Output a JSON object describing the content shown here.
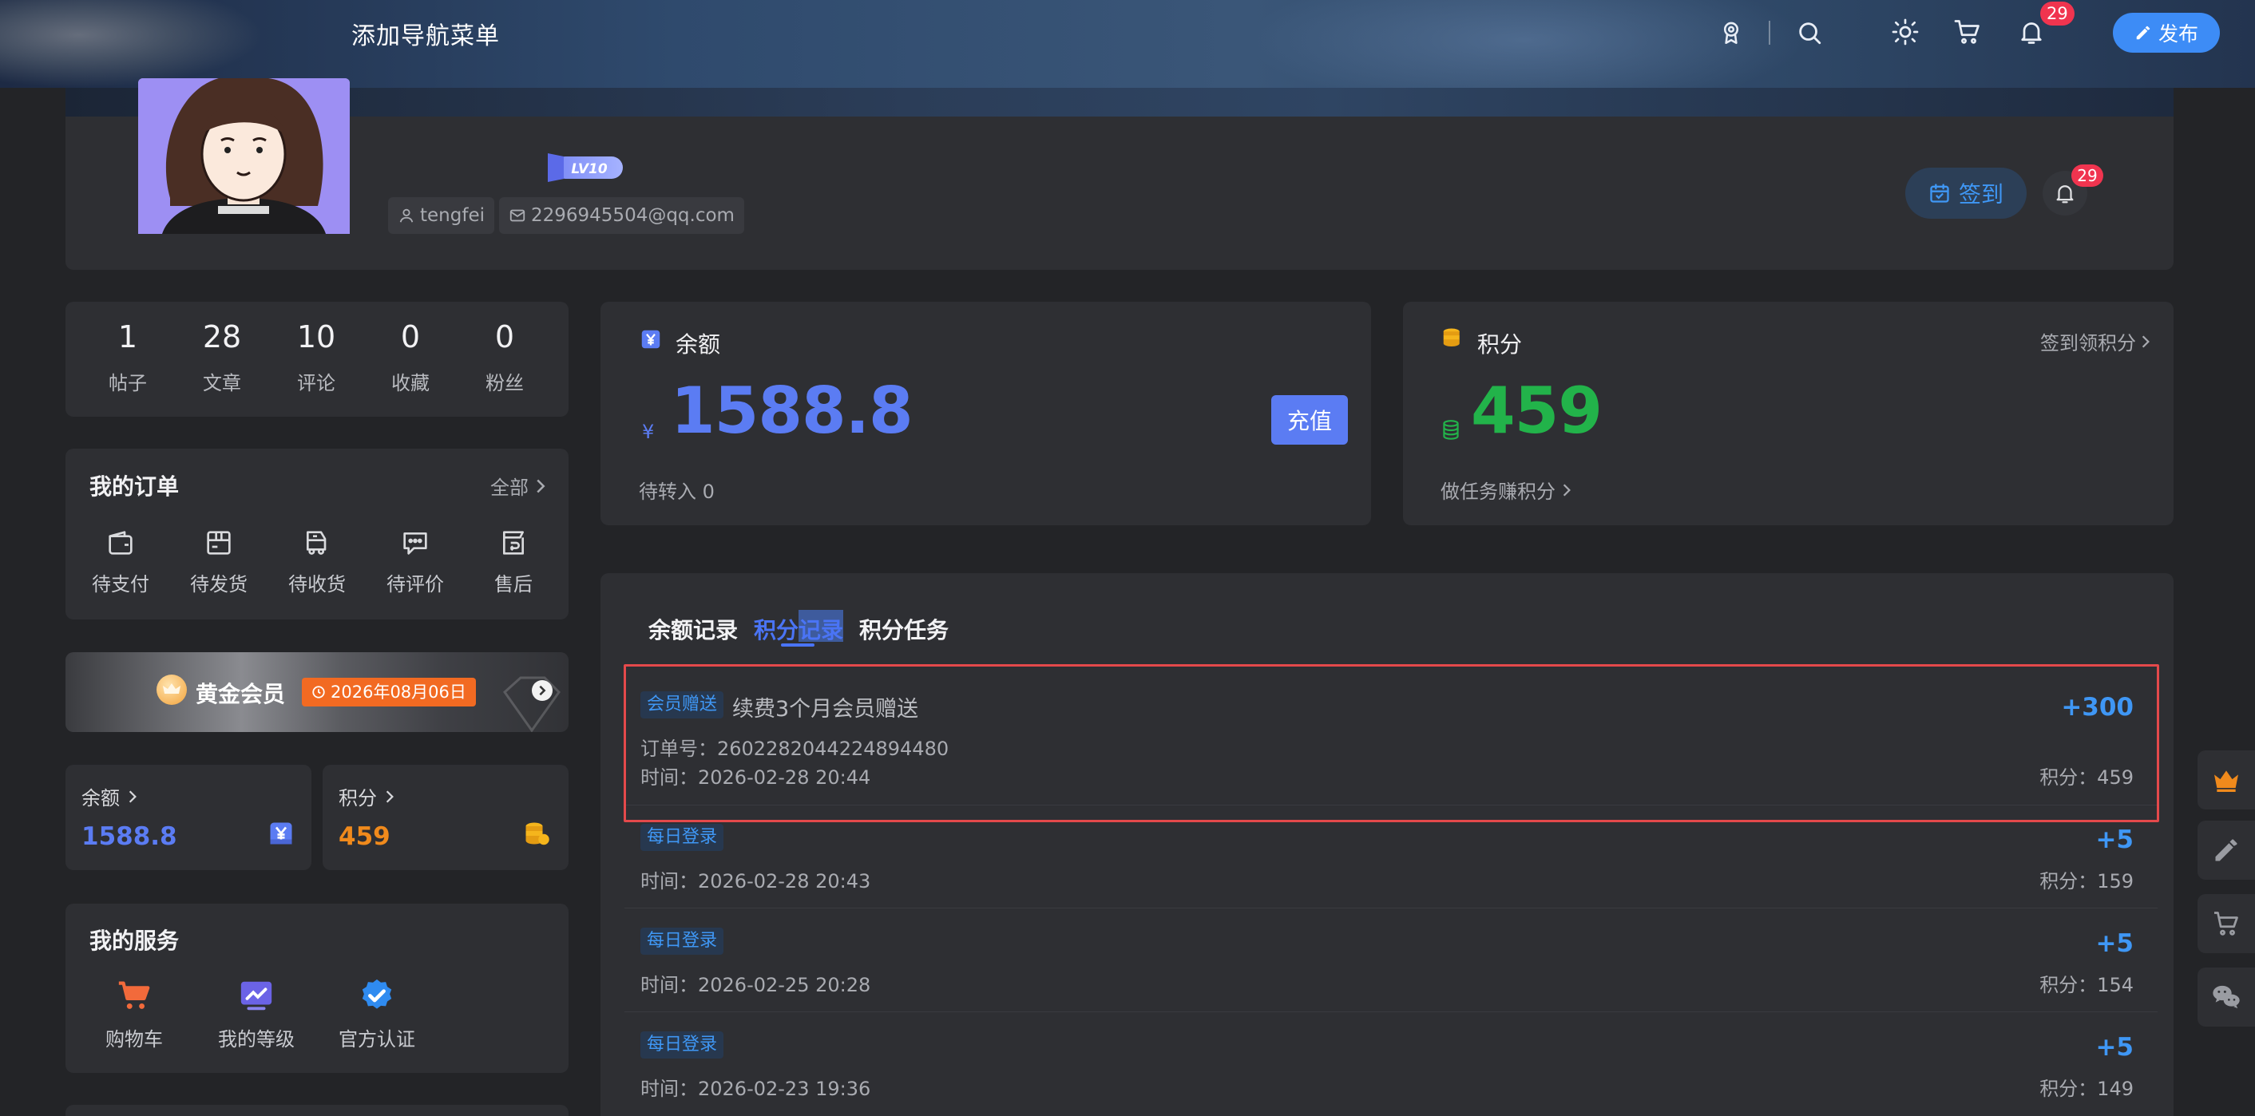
{
  "header": {
    "nav_title": "添加导航菜单",
    "notification_count": "29",
    "publish_label": "发布"
  },
  "profile": {
    "level": "LV10",
    "username": "tengfei",
    "email": "2296945504@qq.com",
    "signin_label": "签到",
    "notification_count": "29"
  },
  "stats": [
    {
      "value": "1",
      "label": "帖子"
    },
    {
      "value": "28",
      "label": "文章"
    },
    {
      "value": "10",
      "label": "评论"
    },
    {
      "value": "0",
      "label": "收藏"
    },
    {
      "value": "0",
      "label": "粉丝"
    }
  ],
  "orders": {
    "title": "我的订单",
    "all_label": "全部",
    "items": [
      {
        "label": "待支付",
        "icon": "wallet-icon"
      },
      {
        "label": "待发货",
        "icon": "package-icon"
      },
      {
        "label": "待收货",
        "icon": "truck-icon"
      },
      {
        "label": "待评价",
        "icon": "comment-icon"
      },
      {
        "label": "售后",
        "icon": "return-icon"
      }
    ]
  },
  "vip": {
    "name": "黄金会员",
    "expiry": "2026年08月06日"
  },
  "mini_balance": {
    "title": "余额",
    "value": "1588.8"
  },
  "mini_points": {
    "title": "积分",
    "value": "459"
  },
  "services": {
    "title": "我的服务",
    "items": [
      {
        "label": "购物车",
        "icon": "cart-icon"
      },
      {
        "label": "我的等级",
        "icon": "level-chart-icon"
      },
      {
        "label": "官方认证",
        "icon": "verified-icon"
      }
    ]
  },
  "balance": {
    "title": "余额",
    "currency": "¥",
    "amount": "1588.8",
    "pending": "待转入 0",
    "recharge_label": "充值"
  },
  "points": {
    "title": "积分",
    "signin_link": "签到领积分",
    "amount": "459",
    "task_link": "做任务赚积分"
  },
  "records": {
    "tabs": [
      "余额记录",
      "积分记录",
      "积分任务"
    ],
    "items": [
      {
        "tag": "会员赠送",
        "desc": "续费3个月会员赠送",
        "delta": "+300",
        "order": "订单号：2602282044224894480",
        "time": "时间：2026-02-28 20:44",
        "balance": "积分：459"
      },
      {
        "tag": "每日登录",
        "desc": "",
        "delta": "+5",
        "order": "",
        "time": "时间：2026-02-28 20:43",
        "balance": "积分：159"
      },
      {
        "tag": "每日登录",
        "desc": "",
        "delta": "+5",
        "order": "",
        "time": "时间：2026-02-25 20:28",
        "balance": "积分：154"
      },
      {
        "tag": "每日登录",
        "desc": "",
        "delta": "+5",
        "order": "",
        "time": "时间：2026-02-23 19:36",
        "balance": "积分：149"
      }
    ]
  },
  "colors": {
    "accent_blue": "#3f97f5",
    "balance_blue": "#5b7cf3",
    "points_green": "#22b34a",
    "points_orange": "#f08a1c",
    "badge_red": "#f0344f",
    "highlight_red": "#e4494b"
  }
}
